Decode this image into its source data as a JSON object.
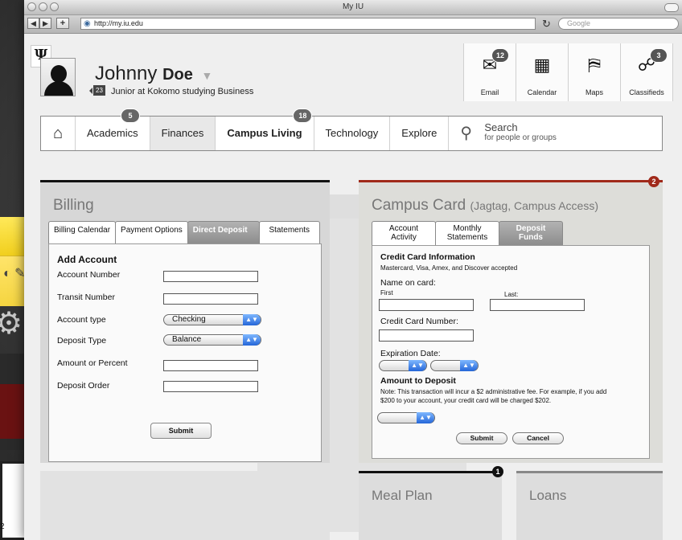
{
  "browser": {
    "title": "My IU",
    "url": "http://my.iu.edu",
    "search_placeholder": "Google",
    "back_label": "◀",
    "forward_label": "▶",
    "add_label": "+"
  },
  "background_app": {
    "number": "2"
  },
  "header": {
    "logo": "Ψ",
    "first_name": "Johnny",
    "last_name": "Doe",
    "message_count": "23",
    "status": "Junior at Kokomo studying Business"
  },
  "quick_links": [
    {
      "label": "Email",
      "badge": "12"
    },
    {
      "label": "Calendar",
      "badge": ""
    },
    {
      "label": "Maps",
      "badge": ""
    },
    {
      "label": "Classifieds",
      "badge": "3"
    }
  ],
  "nav": {
    "items": [
      {
        "label": "Academics",
        "badge": "5"
      },
      {
        "label": "Finances",
        "badge": ""
      },
      {
        "label": "Campus Living",
        "badge": "18"
      },
      {
        "label": "Technology",
        "badge": ""
      },
      {
        "label": "Explore",
        "badge": ""
      }
    ],
    "search_title": "Search",
    "search_subtitle": "for people or groups"
  },
  "billing": {
    "title": "Billing",
    "tabs": [
      "Billing Calendar",
      "Payment Options",
      "Direct Deposit",
      "Statements"
    ],
    "form_title": "Add Account",
    "fields": {
      "account_number": "Account Number",
      "transit_number": "Transit Number",
      "account_type": "Account type",
      "deposit_type": "Deposit Type",
      "amount": "Amount or Percent",
      "order": "Deposit Order"
    },
    "account_type_value": "Checking",
    "deposit_type_value": "Balance",
    "submit_label": "Submit"
  },
  "campus_card": {
    "title": "Campus Card",
    "subtitle": "(Jagtag, Campus Access)",
    "badge": "2",
    "tabs": [
      {
        "line1": "Account",
        "line2": "Activity"
      },
      {
        "line1": "Monthly",
        "line2": "Statements"
      },
      {
        "line1": "Deposit",
        "line2": "Funds"
      }
    ],
    "cc_title": "Credit Card Information",
    "cc_accepted": "Mastercard, Visa, Amex, and Discover accepted",
    "name_label": "Name on card:",
    "first_label": "First",
    "last_label": "Last:",
    "number_label": "Credit Card Number:",
    "expiration_label": "Expiration Date:",
    "amount_title": "Amount to Deposit",
    "note_line1": "Note: This transaction will incur a $2 administrative fee.  For example, if you add",
    "note_line2": "$200 to your account, your credit card will be charged $202.",
    "submit_label": "Submit",
    "cancel_label": "Cancel"
  },
  "meal_plan": {
    "title": "Meal Plan",
    "badge": "1"
  },
  "loans": {
    "title": "Loans"
  }
}
